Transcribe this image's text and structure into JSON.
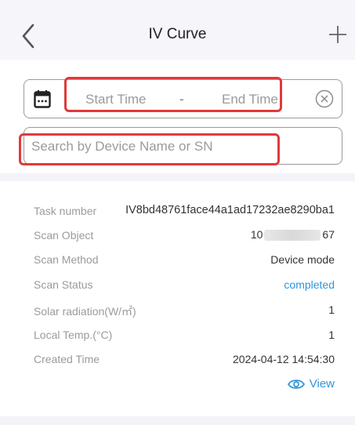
{
  "header": {
    "title": "IV Curve",
    "back_icon": "chevron-left-icon",
    "add_icon": "plus-icon"
  },
  "filter": {
    "start_time_placeholder": "Start Time",
    "separator": "-",
    "end_time_placeholder": "End Time",
    "search_placeholder": "Search by Device Name or SN",
    "calendar_icon": "calendar-icon",
    "clear_icon": "clear-circle-icon"
  },
  "task": {
    "rows": [
      {
        "label": "Task number",
        "value": "IV8bd48761face44a1ad17232ae8290ba1"
      },
      {
        "label": "Scan Object",
        "value_prefix": "10",
        "value_suffix": "67"
      },
      {
        "label": "Scan Method",
        "value": "Device mode"
      },
      {
        "label": "Scan Status",
        "value": "completed"
      },
      {
        "label": "Solar radiation(W/㎡)",
        "value": "1"
      },
      {
        "label": "Local Temp.(°C)",
        "value": "1"
      },
      {
        "label": "Created Time",
        "value": "2024-04-12 14:54:30"
      }
    ],
    "view_label": "View",
    "view_icon": "eye-icon"
  },
  "colors": {
    "accent_blue": "#2f95dc",
    "highlight_red": "#e03a3a",
    "label_gray": "#9b9b9b"
  }
}
